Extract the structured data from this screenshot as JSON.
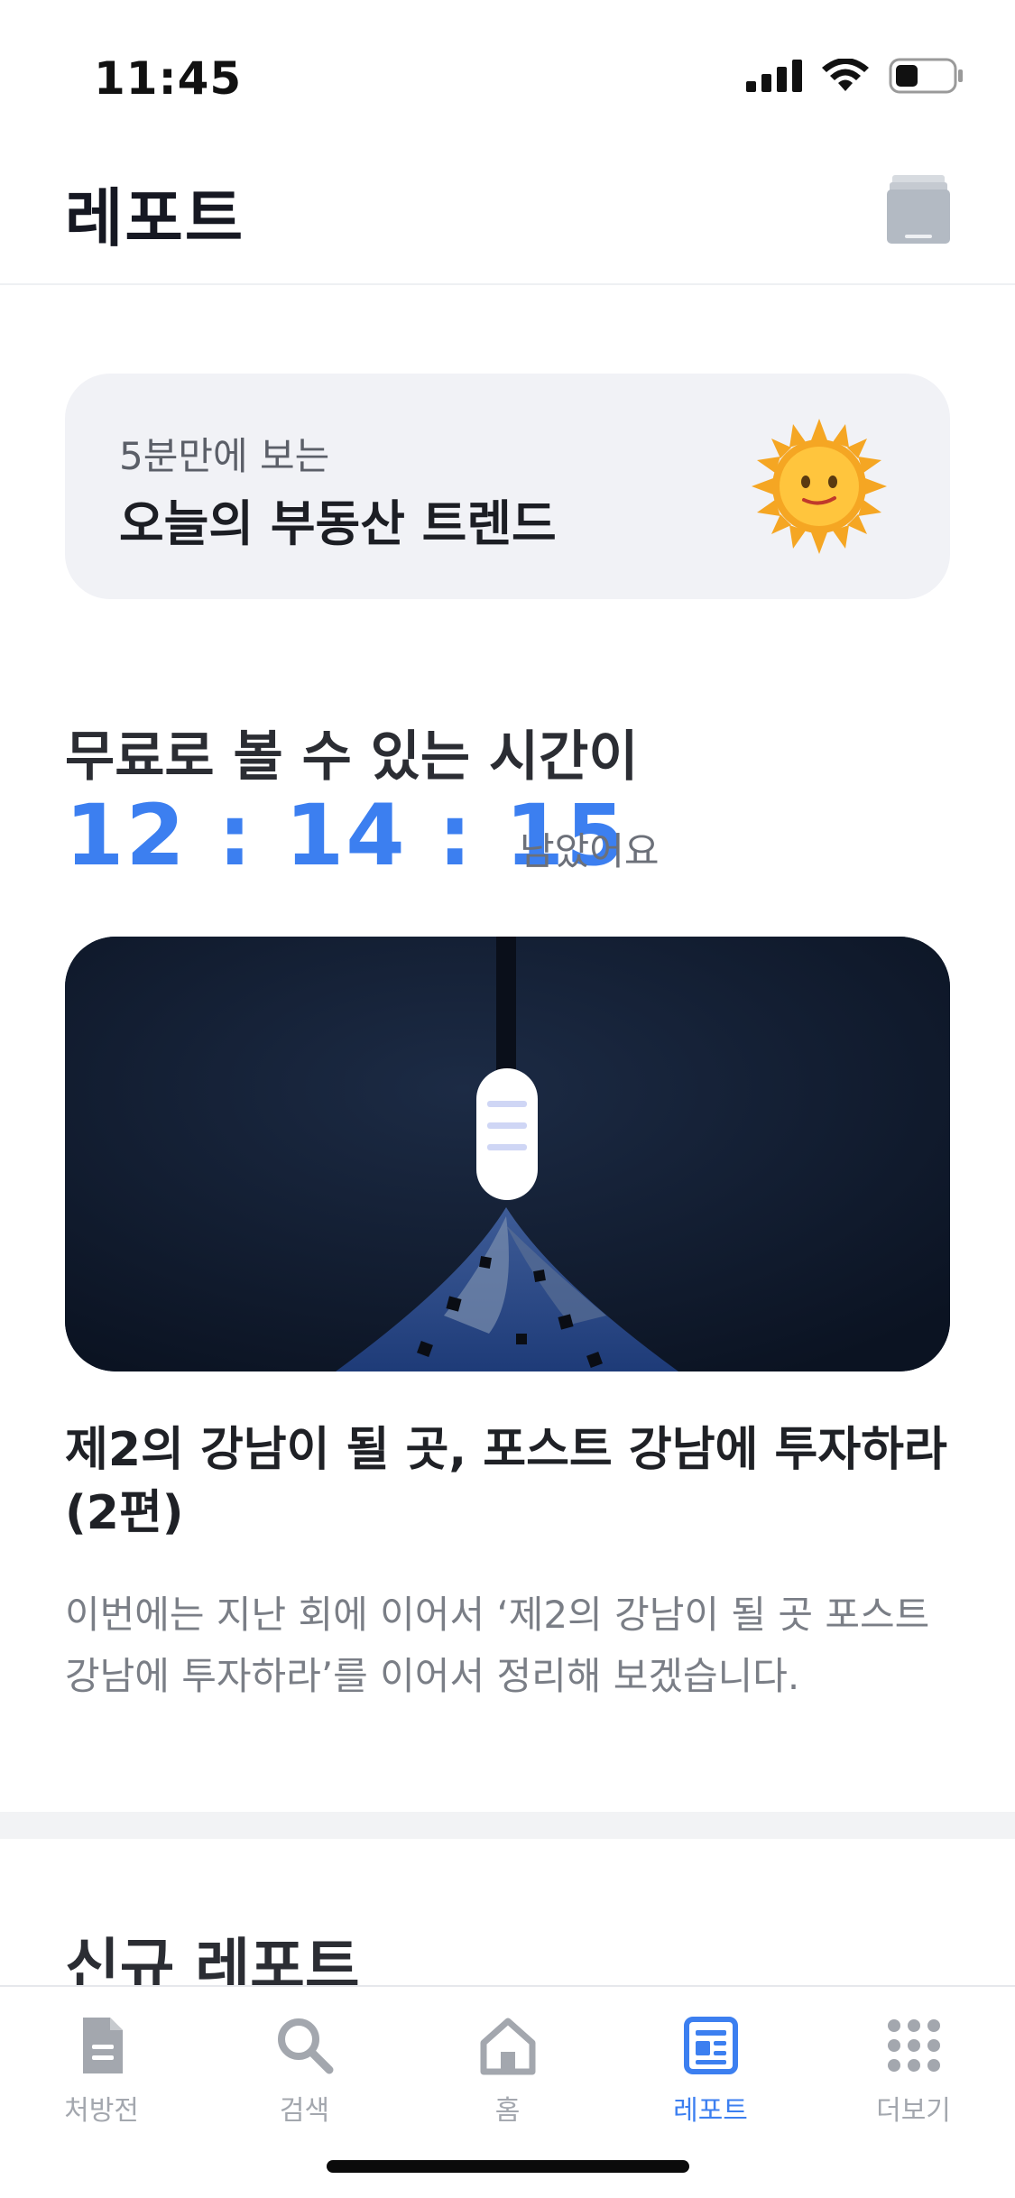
{
  "status_bar": {
    "time": "11:45",
    "icons": [
      "signal-icon",
      "wifi-icon",
      "battery-icon"
    ]
  },
  "header": {
    "title": "레포트",
    "action_icon": "folder-icon"
  },
  "trend_banner": {
    "subtitle": "5분만에 보는",
    "title": "오늘의 부동산 트렌드",
    "icon": "sun-icon"
  },
  "free_section": {
    "heading": "무료로 볼 수 있는 시간이",
    "timer": "12 : 14 : 15",
    "suffix": "남았어요"
  },
  "featured_report": {
    "title": "제2의 강남이 될 곳, 포스트 강남에 투자하라(2편)",
    "description": "이번에는 지난 회에 이어서 ‘제2의 강남이 될 곳 포스트 강남에 투자하라’를 이어서 정리해 보겠습니다."
  },
  "new_section": {
    "heading": "신규 레포트"
  },
  "tab_bar": {
    "tabs": [
      {
        "label": "처방전",
        "icon": "document-icon",
        "active": false
      },
      {
        "label": "검색",
        "icon": "search-icon",
        "active": false
      },
      {
        "label": "홈",
        "icon": "home-icon",
        "active": false
      },
      {
        "label": "레포트",
        "icon": "report-icon",
        "active": true
      },
      {
        "label": "더보기",
        "icon": "more-grid-icon",
        "active": false
      }
    ]
  },
  "colors": {
    "accent": "#3c7ff0",
    "inactive": "#a3a7ae",
    "card_bg": "#f1f2f6"
  }
}
